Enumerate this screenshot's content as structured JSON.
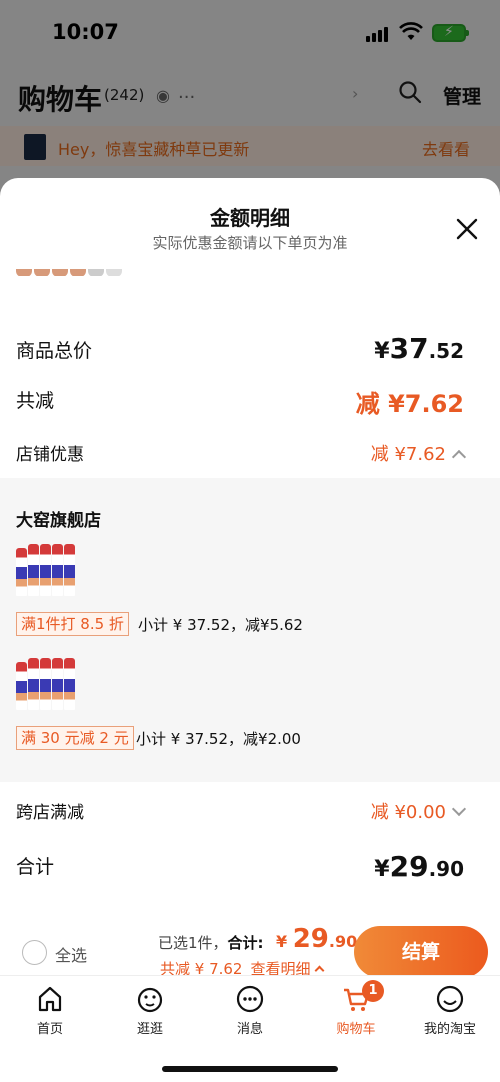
{
  "status_bar": {
    "time": "10:07"
  },
  "cart_header": {
    "title": "购物车",
    "count": "(242)",
    "more": "...",
    "manage_label": "管理"
  },
  "promo_banner": {
    "text": "Hey，惊喜宝藏种草已更新",
    "link": "去看看"
  },
  "sheet": {
    "title": "金额明细",
    "subtitle": "实际优惠金额请以下单页为准",
    "total_price": {
      "label": "商品总价",
      "symbol": "¥",
      "int": "37",
      "dec": ".52"
    },
    "total_discount": {
      "label": "共减",
      "value": "减 ¥7.62"
    },
    "shop_discount": {
      "label": "店铺优惠",
      "value": "减 ¥7.62"
    },
    "shop": {
      "name": "大窑旗舰店",
      "offers": [
        {
          "tag": "满1件打 8.5 折",
          "subtotal": "小计 ¥ 37.52，减¥5.62"
        },
        {
          "tag": "满 30 元减 2 元",
          "subtotal": "小计 ¥ 37.52，减¥2.00"
        }
      ]
    },
    "cross_shop": {
      "label": "跨店满减",
      "value": "减 ¥0.00"
    },
    "sum": {
      "label": "合计",
      "symbol": "¥",
      "int": "29",
      "dec": ".90"
    }
  },
  "checkout": {
    "select_all": "全选",
    "selected_prefix": "已选1件，",
    "total_label": "合计:",
    "pay_symbol": "¥ ",
    "pay_int": "29",
    "pay_dec": ".90",
    "reduce_text": "共减 ¥ 7.62",
    "detail_link": "查看明细",
    "button": "结算"
  },
  "tabs": [
    {
      "label": "首页",
      "icon": "home-icon"
    },
    {
      "label": "逛逛",
      "icon": "browse-icon"
    },
    {
      "label": "消息",
      "icon": "message-icon"
    },
    {
      "label": "购物车",
      "icon": "cart-icon",
      "badge": "1"
    },
    {
      "label": "我的淘宝",
      "icon": "profile-icon"
    }
  ],
  "colors": {
    "accent": "#e85a24",
    "banner_bg": "#fdece0",
    "shop_block_bg": "#f6f6f6"
  }
}
